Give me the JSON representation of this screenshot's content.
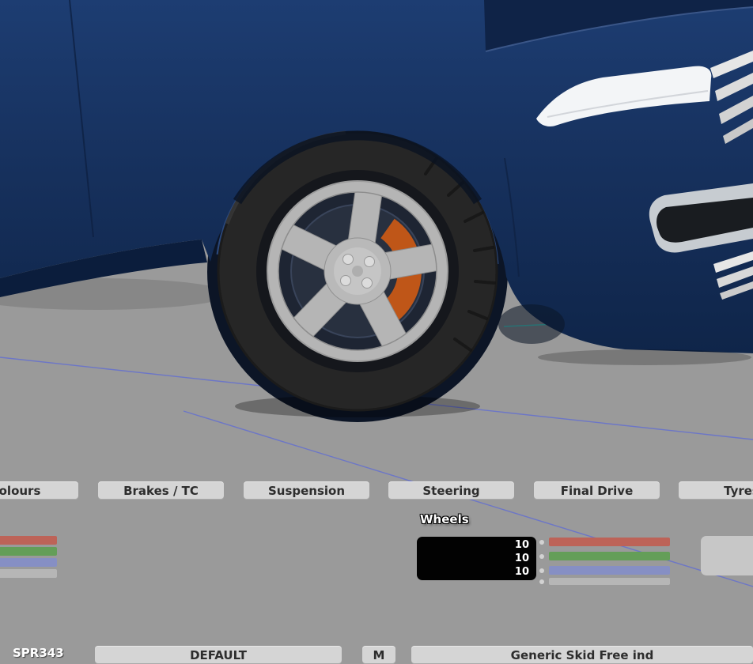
{
  "viewport": {
    "colors": {
      "ground": "#9a9a9a",
      "car_body": "#16305c",
      "grid_line": "#6470cf",
      "accent_line": "#4ddfd0",
      "tire": "#262626",
      "rim": "#b5b5b5",
      "caliper": "#bf5618",
      "headlight": "#f3f5f7",
      "wheel_well": "#0c1526"
    }
  },
  "tabs": [
    {
      "id": "colours",
      "label": "Colours"
    },
    {
      "id": "brakes-tc",
      "label": "Brakes / TC"
    },
    {
      "id": "suspension",
      "label": "Suspension"
    },
    {
      "id": "steering",
      "label": "Steering"
    },
    {
      "id": "final-drive",
      "label": "Final Drive"
    },
    {
      "id": "tyres",
      "label": "Tyres"
    }
  ],
  "wheels_panel": {
    "title": "Wheels",
    "values": [
      "10",
      "10",
      "10"
    ],
    "sliders": [
      {
        "name": "red",
        "color": "#bd6358"
      },
      {
        "name": "green",
        "color": "#649e58"
      },
      {
        "name": "blue",
        "color": "#868fc4"
      },
      {
        "name": "gray",
        "color": "#b6b6b6"
      }
    ]
  },
  "left_sliders": [
    {
      "color": "#bd6358"
    },
    {
      "color": "#649e58"
    },
    {
      "color": "#868fc4"
    },
    {
      "color": "#b6b6b6"
    }
  ],
  "bottom_bar": {
    "car_label": "SPR343",
    "setup_label": "DEFAULT",
    "small_label": "M",
    "wide_label": "Generic Skid Free ind"
  }
}
